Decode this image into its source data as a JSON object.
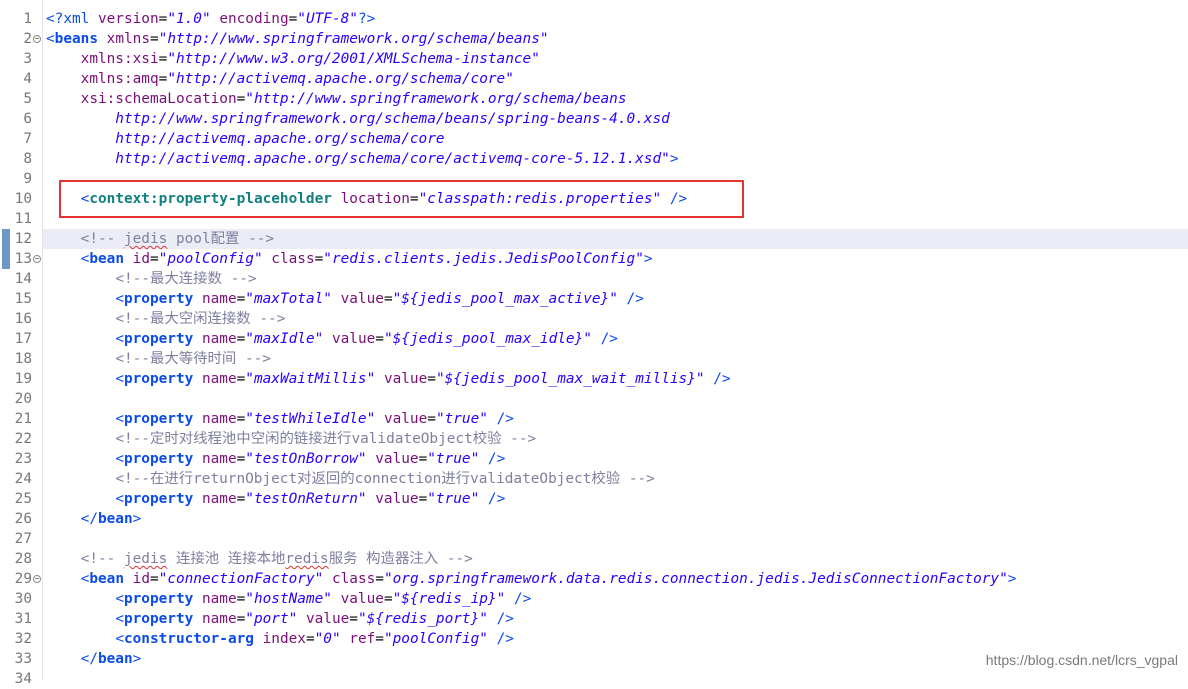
{
  "watermark": "https://blog.csdn.net/lcrs_vgpal",
  "lines": [
    {
      "n": "1",
      "tokens": [
        {
          "c": "pi",
          "t": "<?"
        },
        {
          "c": "pi",
          "t": "xml "
        },
        {
          "c": "attr",
          "t": "version"
        },
        {
          "c": "text",
          "t": "="
        },
        {
          "c": "str",
          "t": "\"1.0\""
        },
        {
          "c": "text",
          "t": " "
        },
        {
          "c": "attr",
          "t": "encoding"
        },
        {
          "c": "text",
          "t": "="
        },
        {
          "c": "str",
          "t": "\"UTF-8\""
        },
        {
          "c": "pi",
          "t": "?>"
        }
      ]
    },
    {
      "n": "2",
      "fold": true,
      "tokens": [
        {
          "c": "bracket",
          "t": "<"
        },
        {
          "c": "el",
          "t": "beans"
        },
        {
          "c": "text",
          "t": " "
        },
        {
          "c": "attr",
          "t": "xmlns"
        },
        {
          "c": "text",
          "t": "="
        },
        {
          "c": "str",
          "t": "\"http://www.springframework.org/schema/beans\""
        }
      ]
    },
    {
      "n": "3",
      "tokens": [
        {
          "c": "text",
          "t": "    "
        },
        {
          "c": "attr",
          "t": "xmlns:xsi"
        },
        {
          "c": "text",
          "t": "="
        },
        {
          "c": "str",
          "t": "\"http://www.w3.org/2001/XMLSchema-instance\""
        }
      ]
    },
    {
      "n": "4",
      "tokens": [
        {
          "c": "text",
          "t": "    "
        },
        {
          "c": "attr",
          "t": "xmlns:amq"
        },
        {
          "c": "text",
          "t": "="
        },
        {
          "c": "str",
          "t": "\"http://activemq.apache.org/schema/core\""
        }
      ]
    },
    {
      "n": "5",
      "tokens": [
        {
          "c": "text",
          "t": "    "
        },
        {
          "c": "attr",
          "t": "xsi:schemaLocation"
        },
        {
          "c": "text",
          "t": "="
        },
        {
          "c": "str",
          "t": "\"http://www.springframework.org/schema/beans"
        }
      ]
    },
    {
      "n": "6",
      "tokens": [
        {
          "c": "str",
          "t": "        http://www.springframework.org/schema/beans/spring-beans-4.0.xsd"
        }
      ]
    },
    {
      "n": "7",
      "tokens": [
        {
          "c": "str",
          "t": "        http://activemq.apache.org/schema/core"
        }
      ]
    },
    {
      "n": "8",
      "tokens": [
        {
          "c": "str",
          "t": "        http://activemq.apache.org/schema/core/activemq-core-5.12.1.xsd\""
        },
        {
          "c": "bracket",
          "t": ">"
        }
      ]
    },
    {
      "n": "9",
      "tokens": []
    },
    {
      "n": "10",
      "tokens": [
        {
          "c": "text",
          "t": "    "
        },
        {
          "c": "bracket",
          "t": "<"
        },
        {
          "c": "el-teal",
          "t": "context:property-placeholder"
        },
        {
          "c": "text",
          "t": " "
        },
        {
          "c": "attr",
          "t": "location"
        },
        {
          "c": "text",
          "t": "="
        },
        {
          "c": "str",
          "t": "\"classpath:redis.properties\""
        },
        {
          "c": "text",
          "t": " "
        },
        {
          "c": "bracket",
          "t": "/>"
        }
      ]
    },
    {
      "n": "11",
      "tokens": []
    },
    {
      "n": "12",
      "marker": true,
      "tokens": [
        {
          "c": "text",
          "t": "    "
        },
        {
          "c": "cm",
          "t": "<!-- "
        },
        {
          "c": "cm-sq",
          "t": "jedis"
        },
        {
          "c": "cm",
          "t": " pool配置 -->"
        }
      ]
    },
    {
      "n": "13",
      "fold": true,
      "marker": true,
      "tokens": [
        {
          "c": "text",
          "t": "    "
        },
        {
          "c": "bracket",
          "t": "<"
        },
        {
          "c": "el",
          "t": "bean"
        },
        {
          "c": "text",
          "t": " "
        },
        {
          "c": "attr",
          "t": "id"
        },
        {
          "c": "text",
          "t": "="
        },
        {
          "c": "str",
          "t": "\"poolConfig\""
        },
        {
          "c": "text",
          "t": " "
        },
        {
          "c": "attr",
          "t": "class"
        },
        {
          "c": "text",
          "t": "="
        },
        {
          "c": "str",
          "t": "\"redis.clients.jedis.JedisPoolConfig\""
        },
        {
          "c": "bracket",
          "t": ">"
        }
      ]
    },
    {
      "n": "14",
      "tokens": [
        {
          "c": "text",
          "t": "        "
        },
        {
          "c": "cm",
          "t": "<!--最大连接数 -->"
        }
      ]
    },
    {
      "n": "15",
      "tokens": [
        {
          "c": "text",
          "t": "        "
        },
        {
          "c": "bracket",
          "t": "<"
        },
        {
          "c": "el",
          "t": "property"
        },
        {
          "c": "text",
          "t": " "
        },
        {
          "c": "attr",
          "t": "name"
        },
        {
          "c": "text",
          "t": "="
        },
        {
          "c": "str",
          "t": "\"maxTotal\""
        },
        {
          "c": "text",
          "t": " "
        },
        {
          "c": "attr",
          "t": "value"
        },
        {
          "c": "text",
          "t": "="
        },
        {
          "c": "str",
          "t": "\"${jedis_pool_max_active}\""
        },
        {
          "c": "text",
          "t": " "
        },
        {
          "c": "bracket",
          "t": "/>"
        }
      ]
    },
    {
      "n": "16",
      "tokens": [
        {
          "c": "text",
          "t": "        "
        },
        {
          "c": "cm",
          "t": "<!--最大空闲连接数 -->"
        }
      ]
    },
    {
      "n": "17",
      "tokens": [
        {
          "c": "text",
          "t": "        "
        },
        {
          "c": "bracket",
          "t": "<"
        },
        {
          "c": "el",
          "t": "property"
        },
        {
          "c": "text",
          "t": " "
        },
        {
          "c": "attr",
          "t": "name"
        },
        {
          "c": "text",
          "t": "="
        },
        {
          "c": "str",
          "t": "\"maxIdle\""
        },
        {
          "c": "text",
          "t": " "
        },
        {
          "c": "attr",
          "t": "value"
        },
        {
          "c": "text",
          "t": "="
        },
        {
          "c": "str",
          "t": "\"${jedis_pool_max_idle}\""
        },
        {
          "c": "text",
          "t": " "
        },
        {
          "c": "bracket",
          "t": "/>"
        }
      ]
    },
    {
      "n": "18",
      "tokens": [
        {
          "c": "text",
          "t": "        "
        },
        {
          "c": "cm",
          "t": "<!--最大等待时间 -->"
        }
      ]
    },
    {
      "n": "19",
      "tokens": [
        {
          "c": "text",
          "t": "        "
        },
        {
          "c": "bracket",
          "t": "<"
        },
        {
          "c": "el",
          "t": "property"
        },
        {
          "c": "text",
          "t": " "
        },
        {
          "c": "attr",
          "t": "name"
        },
        {
          "c": "text",
          "t": "="
        },
        {
          "c": "str",
          "t": "\"maxWaitMillis\""
        },
        {
          "c": "text",
          "t": " "
        },
        {
          "c": "attr",
          "t": "value"
        },
        {
          "c": "text",
          "t": "="
        },
        {
          "c": "str",
          "t": "\"${jedis_pool_max_wait_millis}\""
        },
        {
          "c": "text",
          "t": " "
        },
        {
          "c": "bracket",
          "t": "/>"
        }
      ]
    },
    {
      "n": "20",
      "tokens": []
    },
    {
      "n": "21",
      "tokens": [
        {
          "c": "text",
          "t": "        "
        },
        {
          "c": "bracket",
          "t": "<"
        },
        {
          "c": "el",
          "t": "property"
        },
        {
          "c": "text",
          "t": " "
        },
        {
          "c": "attr",
          "t": "name"
        },
        {
          "c": "text",
          "t": "="
        },
        {
          "c": "str",
          "t": "\"testWhileIdle\""
        },
        {
          "c": "text",
          "t": " "
        },
        {
          "c": "attr",
          "t": "value"
        },
        {
          "c": "text",
          "t": "="
        },
        {
          "c": "str",
          "t": "\"true\""
        },
        {
          "c": "text",
          "t": " "
        },
        {
          "c": "bracket",
          "t": "/>"
        }
      ]
    },
    {
      "n": "22",
      "tokens": [
        {
          "c": "text",
          "t": "        "
        },
        {
          "c": "cm",
          "t": "<!--定时对线程池中空闲的链接进行validateObject校验 -->"
        }
      ]
    },
    {
      "n": "23",
      "tokens": [
        {
          "c": "text",
          "t": "        "
        },
        {
          "c": "bracket",
          "t": "<"
        },
        {
          "c": "el",
          "t": "property"
        },
        {
          "c": "text",
          "t": " "
        },
        {
          "c": "attr",
          "t": "name"
        },
        {
          "c": "text",
          "t": "="
        },
        {
          "c": "str",
          "t": "\"testOnBorrow\""
        },
        {
          "c": "text",
          "t": " "
        },
        {
          "c": "attr",
          "t": "value"
        },
        {
          "c": "text",
          "t": "="
        },
        {
          "c": "str",
          "t": "\"true\""
        },
        {
          "c": "text",
          "t": " "
        },
        {
          "c": "bracket",
          "t": "/>"
        }
      ]
    },
    {
      "n": "24",
      "tokens": [
        {
          "c": "text",
          "t": "        "
        },
        {
          "c": "cm",
          "t": "<!--在进行returnObject对返回的connection进行validateObject校验 -->"
        }
      ]
    },
    {
      "n": "25",
      "tokens": [
        {
          "c": "text",
          "t": "        "
        },
        {
          "c": "bracket",
          "t": "<"
        },
        {
          "c": "el",
          "t": "property"
        },
        {
          "c": "text",
          "t": " "
        },
        {
          "c": "attr",
          "t": "name"
        },
        {
          "c": "text",
          "t": "="
        },
        {
          "c": "str",
          "t": "\"testOnReturn\""
        },
        {
          "c": "text",
          "t": " "
        },
        {
          "c": "attr",
          "t": "value"
        },
        {
          "c": "text",
          "t": "="
        },
        {
          "c": "str",
          "t": "\"true\""
        },
        {
          "c": "text",
          "t": " "
        },
        {
          "c": "bracket",
          "t": "/>"
        }
      ]
    },
    {
      "n": "26",
      "tokens": [
        {
          "c": "text",
          "t": "    "
        },
        {
          "c": "bracket",
          "t": "</"
        },
        {
          "c": "el",
          "t": "bean"
        },
        {
          "c": "bracket",
          "t": ">"
        }
      ]
    },
    {
      "n": "27",
      "tokens": []
    },
    {
      "n": "28",
      "tokens": [
        {
          "c": "text",
          "t": "    "
        },
        {
          "c": "cm",
          "t": "<!-- "
        },
        {
          "c": "cm-sq",
          "t": "jedis"
        },
        {
          "c": "cm",
          "t": " 连接池 连接本地"
        },
        {
          "c": "cm-sq",
          "t": "redis"
        },
        {
          "c": "cm",
          "t": "服务 构造器注入 -->"
        }
      ]
    },
    {
      "n": "29",
      "fold": true,
      "tokens": [
        {
          "c": "text",
          "t": "    "
        },
        {
          "c": "bracket",
          "t": "<"
        },
        {
          "c": "el",
          "t": "bean"
        },
        {
          "c": "text",
          "t": " "
        },
        {
          "c": "attr",
          "t": "id"
        },
        {
          "c": "text",
          "t": "="
        },
        {
          "c": "str",
          "t": "\"connectionFactory\""
        },
        {
          "c": "text",
          "t": " "
        },
        {
          "c": "attr",
          "t": "class"
        },
        {
          "c": "text",
          "t": "="
        },
        {
          "c": "str",
          "t": "\"org.springframework.data.redis.connection.jedis.JedisConnectionFactory\""
        },
        {
          "c": "bracket",
          "t": ">"
        }
      ]
    },
    {
      "n": "30",
      "tokens": [
        {
          "c": "text",
          "t": "        "
        },
        {
          "c": "bracket",
          "t": "<"
        },
        {
          "c": "el",
          "t": "property"
        },
        {
          "c": "text",
          "t": " "
        },
        {
          "c": "attr",
          "t": "name"
        },
        {
          "c": "text",
          "t": "="
        },
        {
          "c": "str",
          "t": "\"hostName\""
        },
        {
          "c": "text",
          "t": " "
        },
        {
          "c": "attr",
          "t": "value"
        },
        {
          "c": "text",
          "t": "="
        },
        {
          "c": "str",
          "t": "\"${redis_ip}\""
        },
        {
          "c": "text",
          "t": " "
        },
        {
          "c": "bracket",
          "t": "/>"
        }
      ]
    },
    {
      "n": "31",
      "tokens": [
        {
          "c": "text",
          "t": "        "
        },
        {
          "c": "bracket",
          "t": "<"
        },
        {
          "c": "el",
          "t": "property"
        },
        {
          "c": "text",
          "t": " "
        },
        {
          "c": "attr",
          "t": "name"
        },
        {
          "c": "text",
          "t": "="
        },
        {
          "c": "str",
          "t": "\"port\""
        },
        {
          "c": "text",
          "t": " "
        },
        {
          "c": "attr",
          "t": "value"
        },
        {
          "c": "text",
          "t": "="
        },
        {
          "c": "str",
          "t": "\"${redis_port}\""
        },
        {
          "c": "text",
          "t": " "
        },
        {
          "c": "bracket",
          "t": "/>"
        }
      ]
    },
    {
      "n": "32",
      "tokens": [
        {
          "c": "text",
          "t": "        "
        },
        {
          "c": "bracket",
          "t": "<"
        },
        {
          "c": "el",
          "t": "constructor-arg"
        },
        {
          "c": "text",
          "t": " "
        },
        {
          "c": "attr",
          "t": "index"
        },
        {
          "c": "text",
          "t": "="
        },
        {
          "c": "str",
          "t": "\"0\""
        },
        {
          "c": "text",
          "t": " "
        },
        {
          "c": "attr",
          "t": "ref"
        },
        {
          "c": "text",
          "t": "="
        },
        {
          "c": "str",
          "t": "\"poolConfig\""
        },
        {
          "c": "text",
          "t": " "
        },
        {
          "c": "bracket",
          "t": "/>"
        }
      ]
    },
    {
      "n": "33",
      "tokens": [
        {
          "c": "text",
          "t": "    "
        },
        {
          "c": "bracket",
          "t": "</"
        },
        {
          "c": "el",
          "t": "bean"
        },
        {
          "c": "bracket",
          "t": ">"
        }
      ]
    },
    {
      "n": "34",
      "tokens": []
    }
  ]
}
